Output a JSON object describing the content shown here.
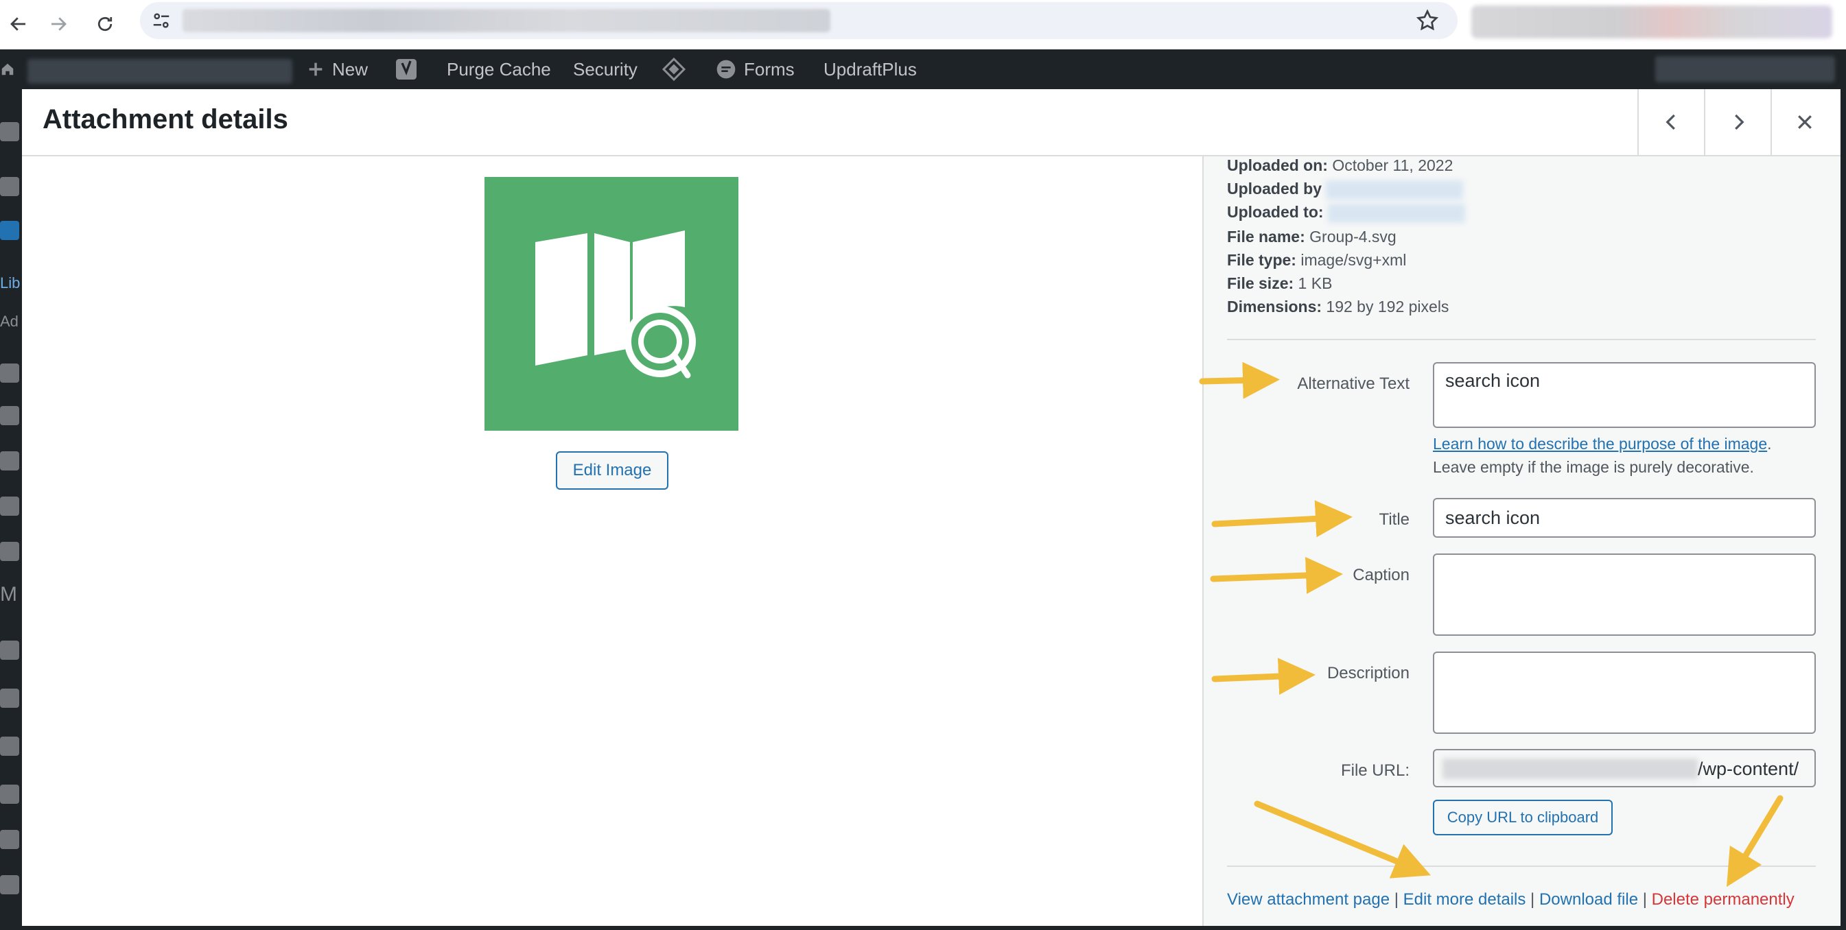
{
  "browser": {
    "back_icon": "back-arrow-icon",
    "forward_icon": "forward-arrow-icon",
    "reload_icon": "reload-icon",
    "bookmark_icon": "star-icon"
  },
  "admin_bar": {
    "new_label": "New",
    "purge_cache_label": "Purge Cache",
    "security_label": "Security",
    "forms_label": "Forms",
    "updraft_label": "UpdraftPlus"
  },
  "admin_menu": {
    "library_label": "Lib",
    "add_label": "Ad",
    "m_label": "M"
  },
  "modal": {
    "title": "Attachment details",
    "edit_image_label": "Edit Image"
  },
  "details": {
    "uploaded_on_label": "Uploaded on:",
    "uploaded_on_value": "October 11, 2022",
    "uploaded_by_label": "Uploaded by",
    "uploaded_to_label": "Uploaded to:",
    "file_name_label": "File name:",
    "file_name_value": "Group-4.svg",
    "file_type_label": "File type:",
    "file_type_value": "image/svg+xml",
    "file_size_label": "File size:",
    "file_size_value": "1 KB",
    "dimensions_label": "Dimensions:",
    "dimensions_value": "192 by 192 pixels"
  },
  "form": {
    "alt_label": "Alternative Text",
    "alt_value": "search icon",
    "alt_help_link": "Learn how to describe the purpose of the image",
    "alt_help_text": "Leave empty if the image is purely decorative.",
    "title_label": "Title",
    "title_value": "search icon",
    "caption_label": "Caption",
    "caption_value": "",
    "description_label": "Description",
    "description_value": "",
    "file_url_label": "File URL:",
    "file_url_value": "/wp-content/",
    "copy_url_label": "Copy URL to clipboard"
  },
  "actions": {
    "view_attachment": "View attachment page",
    "edit_more": "Edit more details",
    "download": "Download file",
    "delete": "Delete permanently",
    "separator": "|"
  },
  "colors": {
    "preview_bg": "#53ae6d",
    "link": "#2271b1",
    "danger": "#d63638",
    "annotation_arrow": "#f0bc3a",
    "admin_bar": "#1d2327"
  }
}
